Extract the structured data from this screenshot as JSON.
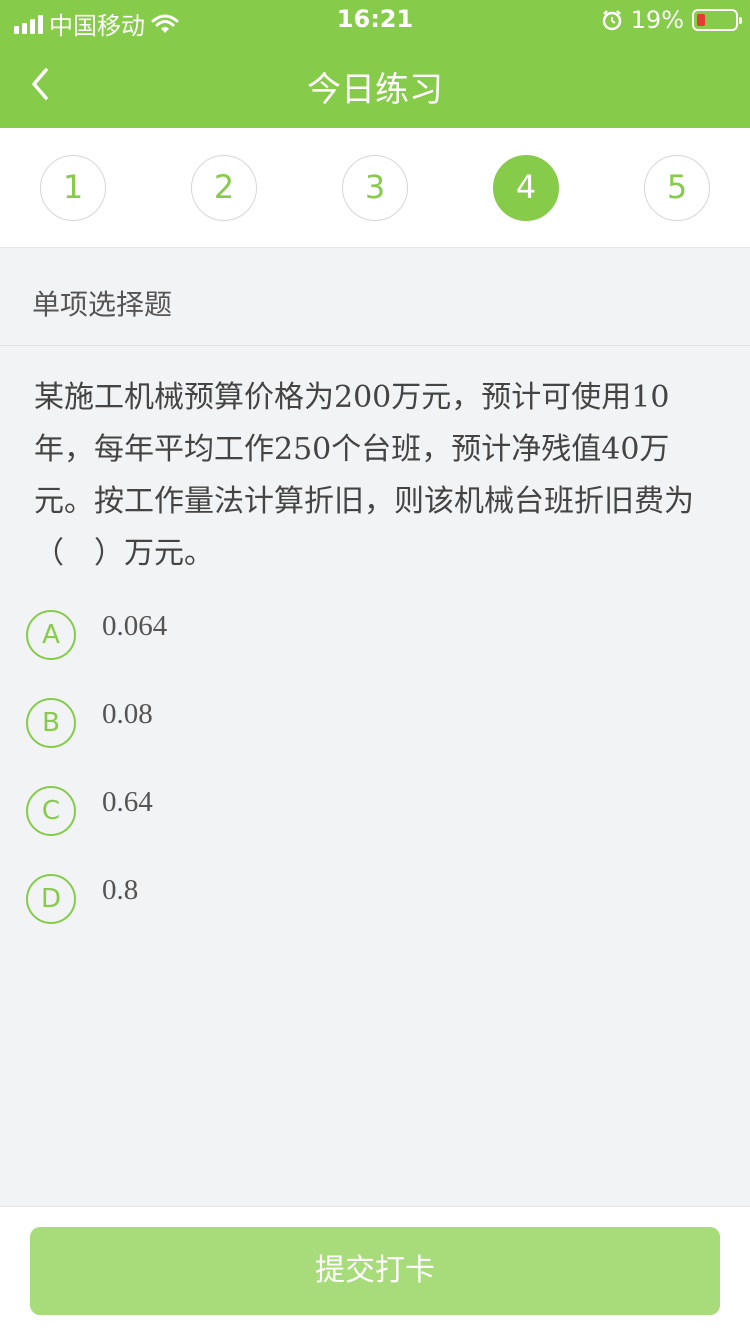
{
  "status_bar": {
    "carrier": "中国移动",
    "time": "16:21",
    "battery": "19%"
  },
  "nav": {
    "title": "今日练习"
  },
  "steps": [
    "1",
    "2",
    "3",
    "4",
    "5"
  ],
  "active_step": "4",
  "question_type": "单项选择题",
  "question": "某施工机械预算价格为200万元，预计可使用10年，每年平均工作250个台班，预计净残值40万元。按工作量法计算折旧，则该机械台班折旧费为（　）万元。",
  "options": [
    {
      "key": "A",
      "text": "0.064"
    },
    {
      "key": "B",
      "text": "0.08"
    },
    {
      "key": "C",
      "text": "0.64"
    },
    {
      "key": "D",
      "text": "0.8"
    }
  ],
  "submit_label": "提交打卡",
  "colors": {
    "accent": "#86cb4a",
    "button": "#a8dc7a",
    "battery_low": "#e53b34"
  }
}
